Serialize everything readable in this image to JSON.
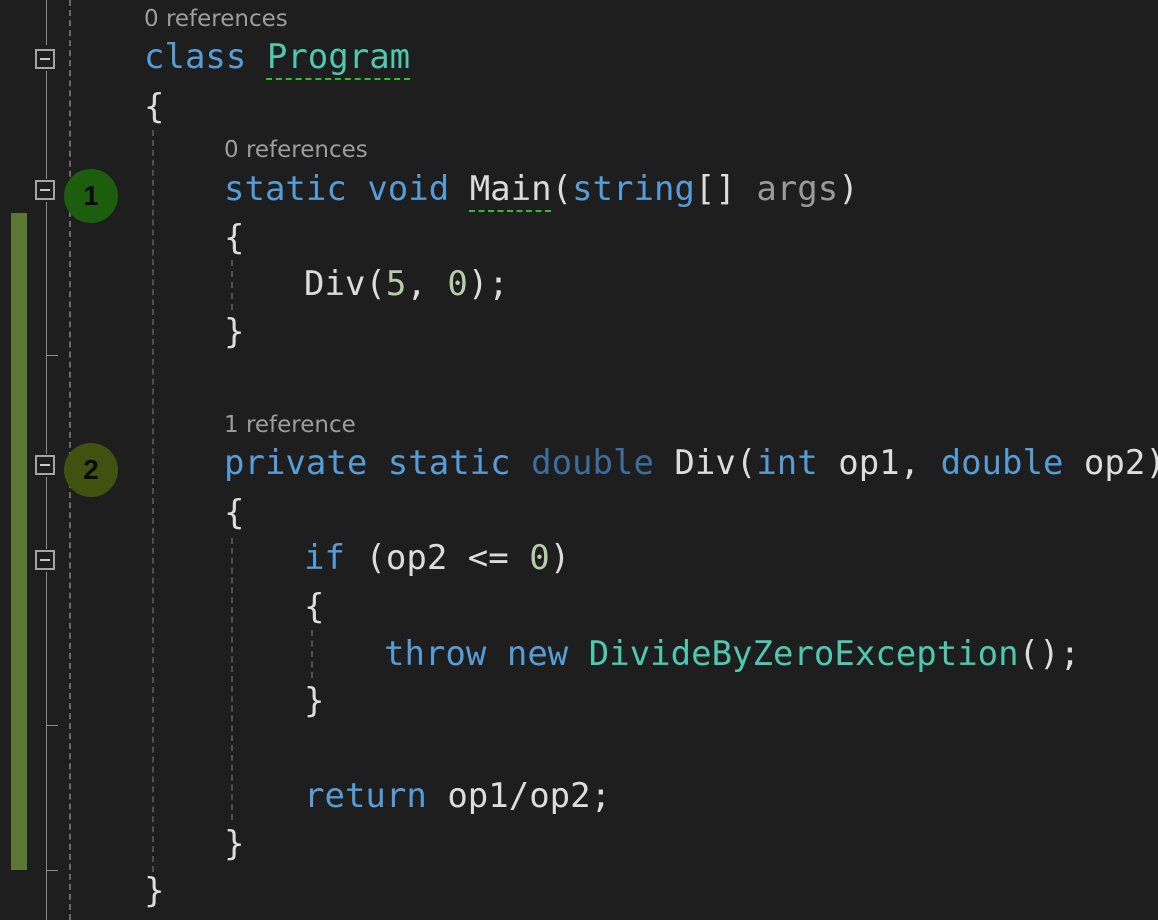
{
  "markers": {
    "step1": "1",
    "step2": "2"
  },
  "codelens": {
    "class_refs": "0 references",
    "main_refs": "0 references",
    "div_refs": "1 reference"
  },
  "code": {
    "class_kw": "class",
    "class_name": "Program",
    "open_brace": "{",
    "close_brace": "}",
    "static_kw": "static",
    "void_kw": "void",
    "main_name": "Main",
    "paren_open": "(",
    "string_kw": "string",
    "array_brackets": "[]",
    "args_name": "args",
    "paren_close": ")",
    "div_call": "Div",
    "call_open": "(",
    "arg_5": "5",
    "comma": ", ",
    "arg_0": "0",
    "call_close": ");",
    "private_kw": "private",
    "double_kw": "double",
    "div_name": "Div",
    "int_kw": "int",
    "op1_param": "op1",
    "op2_param": "op2",
    "if_kw": "if",
    "cond_open": "(",
    "cond_text": "op2 <= ",
    "cond_zero": "0",
    "cond_close": ")",
    "throw_kw": "throw",
    "new_kw": "new",
    "exception_type": "DivideByZeroException",
    "ctor_end": "();",
    "return_kw": "return",
    "return_expr": "op1/op2;"
  }
}
